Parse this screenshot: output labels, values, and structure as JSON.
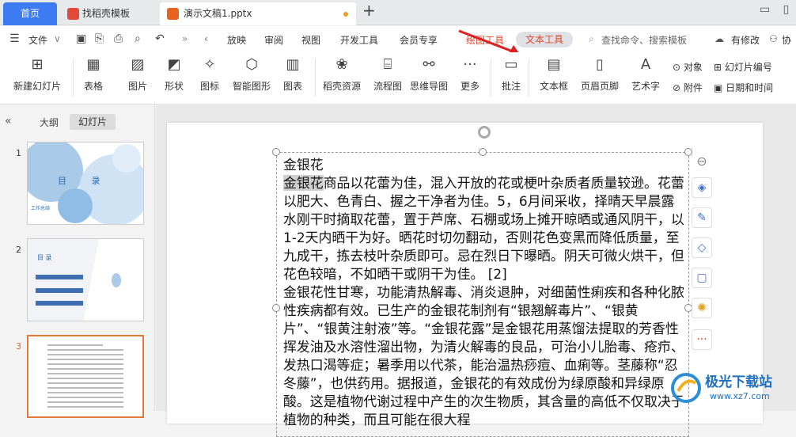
{
  "tabs": [
    {
      "label": "首页"
    },
    {
      "label": "找稻壳模板"
    },
    {
      "label": "演示文稿1.pptx"
    }
  ],
  "menubar": {
    "file": "文件",
    "items": [
      "放映",
      "审阅",
      "视图",
      "开发工具",
      "会员专享",
      "绘图工具",
      "文本工具"
    ],
    "search": "查找命令、搜索模板",
    "modified": "有修改",
    "collab": "协"
  },
  "ribbon": {
    "new_slide": "新建幻灯片",
    "table": "表格",
    "picture": "图片",
    "shape": "形状",
    "icon": "图标",
    "smart": "智能图形",
    "chart": "图表",
    "daoke": "稻壳资源",
    "flow": "流程图",
    "mind": "思维导图",
    "more": "更多",
    "comment": "批注",
    "textbox": "文本框",
    "header_footer": "页眉页脚",
    "art": "艺术字",
    "object": "对象",
    "slide_no": "幻灯片编号",
    "attach": "附件",
    "datetime": "日期和时间"
  },
  "panel": {
    "outline": "大纲",
    "slides": "幻灯片",
    "nums": [
      "1",
      "2",
      "3"
    ],
    "t1_title": "目 录",
    "t1_sub": "工作总结",
    "t2_title": "目 录"
  },
  "slide": {
    "title": "金银花",
    "highlight": "金银花",
    "body": "商品以花蕾为佳，混入开放的花或梗叶杂质者质量较逊。花蕾以肥大、色青白、握之干净者为佳。5，6月间采收，择晴天早晨露水刚干时摘取花蕾，置于芦席、石棚或场上摊开晾晒或通风阴干，以1-2天内晒干为好。晒花时切勿翻动，否则花色变黑而降低质量，至九成干，拣去枝叶杂质即可。忌在烈日下曝晒。阴天可微火烘干，但花色较暗，不如晒干或阴干为佳。 [2]\n金银花性甘寒，功能清热解毒、消炎退肿，对细菌性痢疾和各种化脓性疾病都有效。已生产的金银花制剂有“银翘解毒片”、“银黄片”、“银黄注射液”等。“金银花露”是金银花用蒸馏法提取的芳香性挥发油及水溶性溜出物，为清火解毒的良品，可治小儿胎毒、疮疖、发热口渴等症；暑季用以代茶，能治温热痧痘、血痢等。茎藤称“忍冬藤”，也供药用。据报道，金银花的有效成份为绿原酸和异绿原酸。这是植物代谢过程中产生的次生物质，其含量的高低不仅取决于植物的种类，而且可能在很大程"
  },
  "watermark": {
    "name": "极光下载站",
    "url": "www.xz7.com"
  },
  "colors": {
    "accent": "#3d7bf2",
    "active_tab": "#e2462b"
  }
}
